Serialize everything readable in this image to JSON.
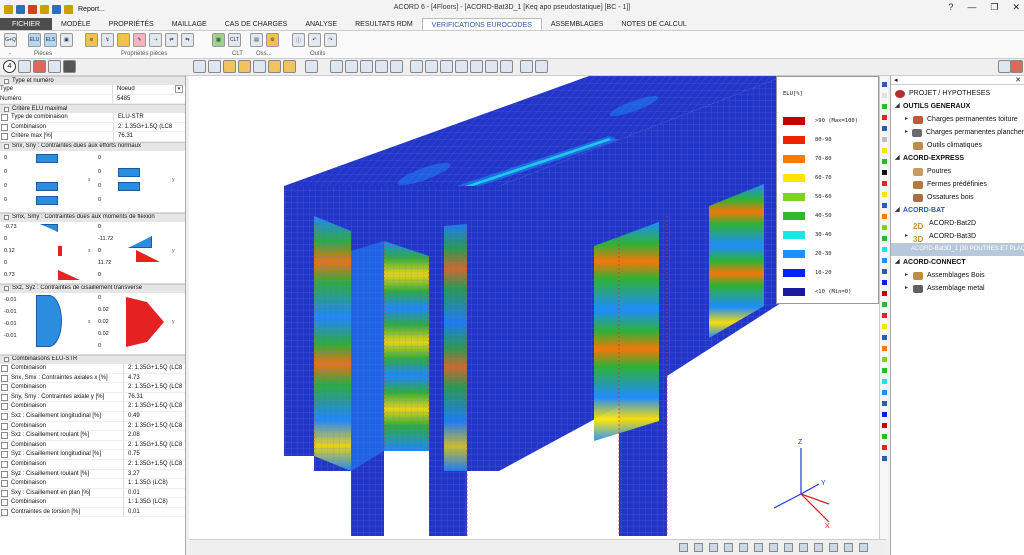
{
  "app": {
    "title": "ACORD 6 - [4Floors] - [ACORD-Bat3D_1 [Keq apo pseudostatique] [BC - 1]]",
    "report_label": "Report...",
    "window_controls": [
      "?",
      "—",
      "❐",
      "✕"
    ]
  },
  "menu": {
    "tabs": [
      "FICHIER",
      "MODÈLE",
      "PROPRIÉTÉS",
      "MAILLAGE",
      "CAS DE CHARGES",
      "ANALYSE",
      "RESULTATS RDM",
      "VERIFICATIONS EUROCODES",
      "ASSEMBLAGES",
      "NOTES DE CALCUL"
    ],
    "active": "VERIFICATIONS EUROCODES"
  },
  "ribbon": {
    "groups": [
      {
        "label": "-",
        "buttons": [
          "G+Q"
        ]
      },
      {
        "label": "Pièces",
        "buttons": [
          "ELU",
          "ELS",
          "▣"
        ]
      },
      {
        "label": "Propriétés pièces",
        "buttons": [
          "≋",
          "↯",
          "⚡",
          "✎",
          "⇢",
          "⇄",
          "⇆"
        ]
      },
      {
        "label": "CLT",
        "buttons": [
          "▦",
          "CLT"
        ]
      },
      {
        "label": "Oss...",
        "buttons": [
          "▤",
          "⚙"
        ]
      },
      {
        "label": "Outils",
        "buttons": [
          "ⓘ",
          "↶",
          "↷"
        ]
      }
    ]
  },
  "left_panel": {
    "header_badge": "4",
    "sections": {
      "type": {
        "title": "Type et numéro",
        "rows": [
          {
            "k": "Type",
            "v": "Noeud"
          },
          {
            "k": "Numéro",
            "v": "5485"
          }
        ]
      },
      "critere": {
        "title": "Critère ELU maximal",
        "rows": [
          {
            "k": "Type de combinaison",
            "v": "ELU-STR"
          },
          {
            "k": "Combinaison",
            "v": "2: 1.35G+1.5Q (LC8"
          },
          {
            "k": "Critère max [%]",
            "v": "76.31"
          }
        ]
      },
      "normaux": {
        "title": "Snx, Sny : Contraintes dues aux efforts normaux",
        "left": [
          "0",
          "0",
          "0",
          "0"
        ],
        "right": [
          "0",
          "0",
          "0",
          "0"
        ],
        "axis_left": "x",
        "axis_right": "y"
      },
      "flexion": {
        "title": "Smx, Smy : Contraintes dues aux moments de flexion",
        "left": [
          "-0.73",
          "0",
          "0.12",
          "0",
          "0.73"
        ],
        "right": [
          "0",
          "-11.72",
          "0",
          "11.72",
          "0"
        ],
        "axis_left": "x",
        "axis_right": "y"
      },
      "cisaillement": {
        "title": "Sxz, Syz : Contraintes de cisaillement transverse",
        "left": [
          "-0.01",
          "-0.01",
          "-0.01",
          "-0.01"
        ],
        "right": [
          "0",
          "0.02",
          "0.02",
          "0.02",
          "0"
        ],
        "axis_left": "x",
        "axis_right": "y"
      },
      "combinaisons": {
        "title": "Combinaisons ELU-STR",
        "rows": [
          {
            "k": "Combinaison",
            "v": "2: 1.35G+1.5Q (LC8"
          },
          {
            "k": "Snx, Smx : Contraintes axiales x [%]",
            "v": "4.73"
          },
          {
            "k": "Combinaison",
            "v": "2: 1.35G+1.5Q (LC8"
          },
          {
            "k": "Sny, Smy : Contraintes axiale y [%]",
            "v": "76.31"
          },
          {
            "k": "Combinaison",
            "v": "2: 1.35G+1.5Q (LC8"
          },
          {
            "k": "Sxz : Cisaillement longitudinal [%]",
            "v": "0.49"
          },
          {
            "k": "Combinaison",
            "v": "2: 1.35G+1.5Q (LC8"
          },
          {
            "k": "Sxz : Cisaillement roulant [%]",
            "v": "2.08"
          },
          {
            "k": "Combinaison",
            "v": "2: 1.35G+1.5Q (LC8"
          },
          {
            "k": "Syz : Cisaillement longitudinal [%]",
            "v": "0.75"
          },
          {
            "k": "Combinaison",
            "v": "2: 1.35G+1.5Q (LC8"
          },
          {
            "k": "Syz : Cisaillement roulant [%]",
            "v": "3.27"
          },
          {
            "k": "Combinaison",
            "v": "1: 1.35G (LC8)"
          },
          {
            "k": "Sxy : Cisaillement en plan [%]",
            "v": "0.01"
          },
          {
            "k": "Combinaison",
            "v": "1: 1.35G (LC8)"
          },
          {
            "k": "Contraintes de torsion [%]",
            "v": "0.01"
          }
        ]
      }
    }
  },
  "legend": {
    "title": "ELU[%]",
    "entries": [
      {
        "label": ">90 (Max=100)",
        "color": "#c40000"
      },
      {
        "label": "80-90",
        "color": "#ee2200"
      },
      {
        "label": "70-80",
        "color": "#ff7a00"
      },
      {
        "label": "60-70",
        "color": "#ffe600"
      },
      {
        "label": "50-60",
        "color": "#7ed321"
      },
      {
        "label": "40-50",
        "color": "#2eb82e"
      },
      {
        "label": "30-40",
        "color": "#19e6e6"
      },
      {
        "label": "20-30",
        "color": "#1e90ff"
      },
      {
        "label": "10-20",
        "color": "#0022ee"
      },
      {
        "label": "<10 (Min=0)",
        "color": "#1a1aa0"
      }
    ]
  },
  "axes": {
    "x": "X",
    "y": "Y",
    "z": "Z"
  },
  "right_panel": {
    "top_left": "◂",
    "top_right": "✕",
    "tree": [
      {
        "label": "PROJET / HYPOTHESES",
        "level": 0,
        "type": "root",
        "color": "#b03030"
      },
      {
        "label": "OUTILS GENERAUX",
        "level": 0,
        "type": "header"
      },
      {
        "label": "Charges permanentes toiture",
        "level": 1,
        "type": "item",
        "color": "#c05a3a"
      },
      {
        "label": "Charges permanentes plancher",
        "level": 1,
        "type": "item",
        "color": "#6a6a6a"
      },
      {
        "label": "Outils climatiques",
        "level": 1,
        "type": "leaf",
        "color": "#c08a50"
      },
      {
        "label": "ACORD-EXPRESS",
        "level": 0,
        "type": "header"
      },
      {
        "label": "Poutres",
        "level": 1,
        "type": "leaf",
        "color": "#c89a60"
      },
      {
        "label": "Fermes prédéfinies",
        "level": 1,
        "type": "leaf",
        "color": "#b07a40"
      },
      {
        "label": "Ossatures bois",
        "level": 1,
        "type": "leaf",
        "color": "#a87040"
      },
      {
        "label": "ACORD-BAT",
        "level": 0,
        "type": "header-blue"
      },
      {
        "label": "ACORD-Bat2D",
        "level": 1,
        "type": "twod",
        "color": "#c89040"
      },
      {
        "label": "ACORD-Bat3D",
        "level": 1,
        "type": "threed",
        "color": "#c89040"
      },
      {
        "label": "ACORD-Bat3D_1 [30 POUTRES ET PLAQ",
        "level": 2,
        "type": "selected"
      },
      {
        "label": "ACORD-CONNECT",
        "level": 0,
        "type": "header"
      },
      {
        "label": "Assemblages Bois",
        "level": 1,
        "type": "item",
        "color": "#c08a40"
      },
      {
        "label": "Assemblage metal",
        "level": 1,
        "type": "item",
        "color": "#606060"
      }
    ]
  },
  "strip_colors": [
    "#2a5ea8",
    "#e0e0e0",
    "#2eb82e",
    "#e62222",
    "#2a5ea8",
    "#c0c0c0",
    "#ffe600",
    "#2eb82e",
    "#111111",
    "#e62222",
    "#ffe600",
    "#2a5ea8",
    "#ff7a00",
    "#7ed321",
    "#2eb82e",
    "#19e6e6",
    "#1e90ff",
    "#2a5ea8",
    "#0022ee",
    "#c40000",
    "#2eb82e",
    "#e62222",
    "#ffe600",
    "#2a5ea8",
    "#ff7a00",
    "#7ed321",
    "#2eb82e",
    "#19e6e6",
    "#1e90ff",
    "#2a5ea8",
    "#0022ee",
    "#c40000",
    "#2eb82e",
    "#e62222",
    "#2a5ea8"
  ]
}
